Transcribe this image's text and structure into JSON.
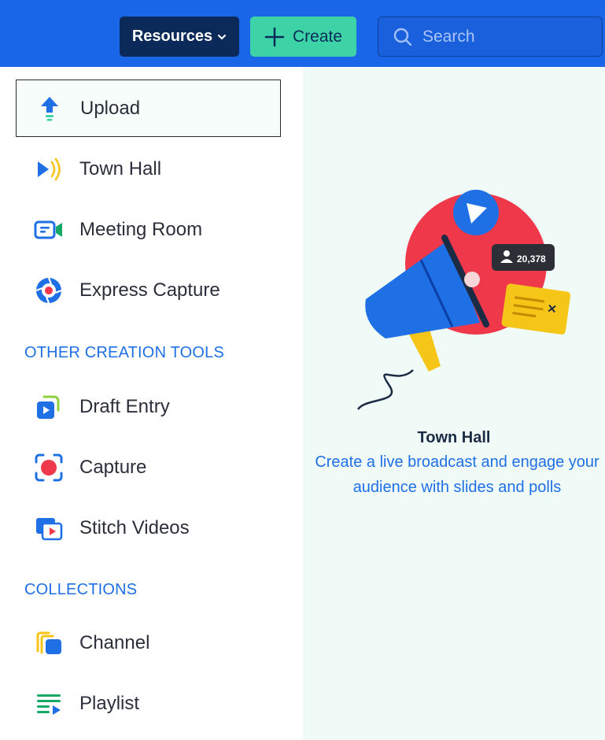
{
  "header": {
    "resources_label": "Resources",
    "create_label": "Create",
    "search_placeholder": "Search"
  },
  "menu": {
    "primary_items": [
      {
        "label": "Upload",
        "icon": "upload-icon",
        "selected": true
      },
      {
        "label": "Town Hall",
        "icon": "town-hall-icon",
        "selected": false
      },
      {
        "label": "Meeting Room",
        "icon": "meeting-room-icon",
        "selected": false
      },
      {
        "label": "Express Capture",
        "icon": "express-capture-icon",
        "selected": false
      }
    ],
    "section_other": "OTHER CREATION TOOLS",
    "other_items": [
      {
        "label": "Draft Entry",
        "icon": "draft-entry-icon"
      },
      {
        "label": "Capture",
        "icon": "capture-icon"
      },
      {
        "label": "Stitch Videos",
        "icon": "stitch-videos-icon"
      }
    ],
    "section_collections": "COLLECTIONS",
    "collection_items": [
      {
        "label": "Channel",
        "icon": "channel-icon"
      },
      {
        "label": "Playlist",
        "icon": "playlist-icon"
      }
    ]
  },
  "preview": {
    "title": "Town Hall",
    "description": "Create a live broadcast and engage your audience with slides and polls",
    "viewer_count": "20,378"
  },
  "colors": {
    "topbar": "#1a66e8",
    "resources_bg": "#0b2a5a",
    "create_bg": "#3dd3a6",
    "accent_blue": "#1f6fe5",
    "preview_bg": "#f0fbf8"
  }
}
